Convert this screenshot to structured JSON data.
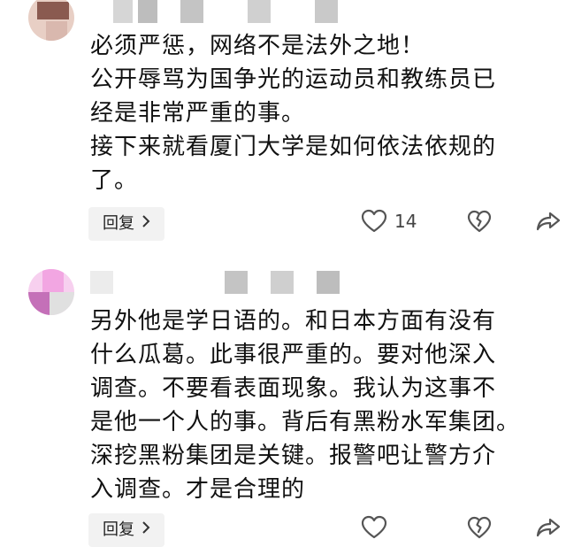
{
  "comments": [
    {
      "username_masked": true,
      "lines": [
        "必须严惩，网络不是法外之地！",
        "公开辱骂为国争光的运动员和教练员已",
        "经是非常严重的事。",
        "接下来就看厦门大学是如何依法依规的",
        "了。"
      ],
      "reply_label": "回复",
      "like_count": "14",
      "icons": {
        "like": "heart-icon",
        "dislike": "broken-heart-icon",
        "share": "share-icon",
        "chevron": "chevron-right-icon"
      },
      "avatar_colors": [
        "#8a5a50",
        "#d9b8ae",
        "#e8cfc5",
        "#b48c80"
      ]
    },
    {
      "username_masked": true,
      "lines": [
        "另外他是学日语的。和日本方面有没有",
        "什么瓜葛。此事很严重的。要对他深入",
        "调查。不要看表面现象。我认为这事不",
        "是他一个人的事。背后有黑粉水军集团。",
        "深挖黑粉集团是关键。报警吧让警方介",
        "入调查。才是合理的"
      ],
      "reply_label": "回复",
      "like_count": "",
      "icons": {
        "like": "heart-icon",
        "dislike": "broken-heart-icon",
        "share": "share-icon",
        "chevron": "chevron-right-icon"
      },
      "avatar_colors": [
        "#f2a6e2",
        "#f7d0ef",
        "#e0e0e0",
        "#c470b8"
      ]
    }
  ],
  "mosaic_color": "#c8c8c8"
}
